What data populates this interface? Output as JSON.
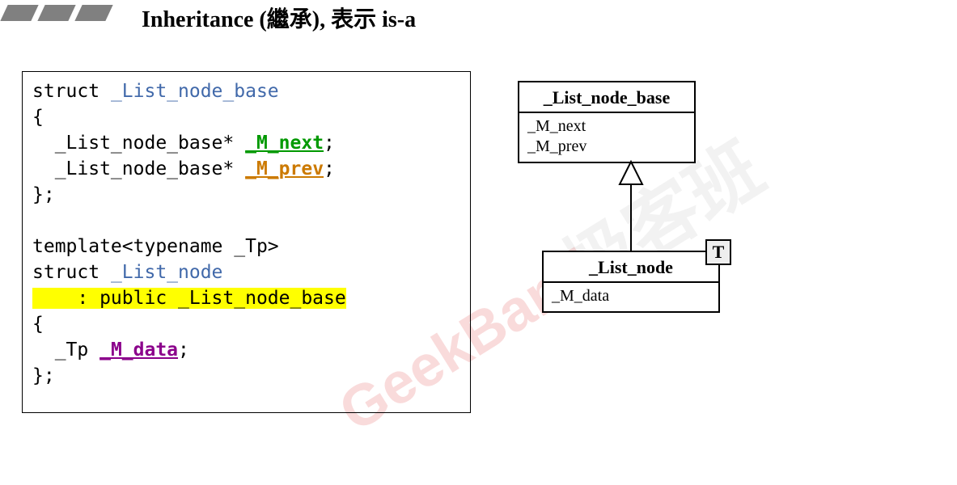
{
  "heading": "Inheritance (繼承), 表示 is-a",
  "watermark_en": "GeekBand",
  "watermark_cn": "极客班",
  "code": {
    "l1_kw": "struct ",
    "l1_type": "_List_node_base",
    "l3a": "  _List_node_base* ",
    "l3b": "_M_next",
    "l4a": "  _List_node_base* ",
    "l4b": "_M_prev",
    "l7": "template<typename _Tp>",
    "l8_kw": "struct ",
    "l8_type": "_List_node",
    "l9": "    : public _List_node_base",
    "l11a": "  _Tp ",
    "l11b": "_M_data"
  },
  "uml": {
    "base": {
      "title": "_List_node_base",
      "m1": "_M_next",
      "m2": "_M_prev"
    },
    "derived": {
      "title": "_List_node",
      "m1": "_M_data",
      "tparam": "T"
    }
  }
}
